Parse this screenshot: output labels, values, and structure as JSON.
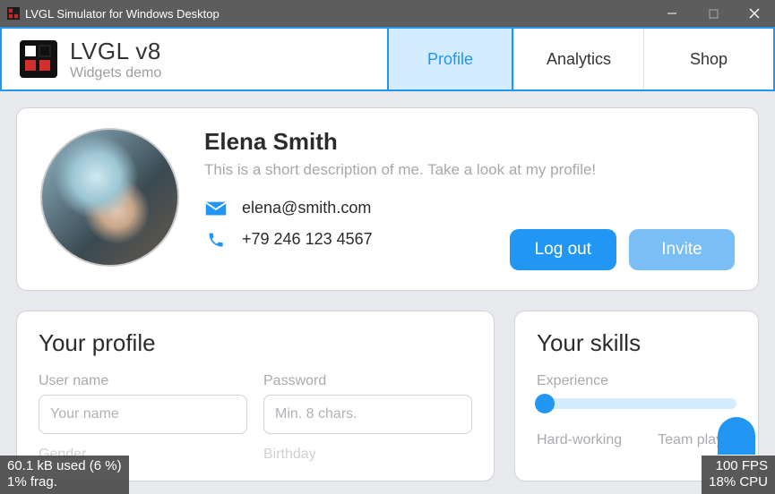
{
  "window": {
    "title": "LVGL Simulator for Windows Desktop"
  },
  "brand": {
    "title": "LVGL v8",
    "subtitle": "Widgets demo"
  },
  "tabs": {
    "items": [
      {
        "label": "Profile",
        "active": true
      },
      {
        "label": "Analytics",
        "active": false
      },
      {
        "label": "Shop",
        "active": false
      }
    ]
  },
  "profile": {
    "name": "Elena Smith",
    "description": "This is a short description of me. Take a look at my profile!",
    "email": "elena@smith.com",
    "phone": "+79 246 123 4567",
    "logout_label": "Log out",
    "invite_label": "Invite"
  },
  "profile_form": {
    "title": "Your profile",
    "username_label": "User name",
    "username_placeholder": "Your name",
    "password_label": "Password",
    "password_placeholder": "Min. 8 chars.",
    "gender_label": "Gender",
    "birthday_label": "Birthday"
  },
  "skills": {
    "title": "Your skills",
    "experience_label": "Experience",
    "experience_value": 0,
    "hard_working_label": "Hard-working",
    "team_player_label": "Team player"
  },
  "stats": {
    "mem_used": "60.1 kB used (6 %)",
    "frag": "1% frag.",
    "fps": "100 FPS",
    "cpu": "18% CPU"
  }
}
